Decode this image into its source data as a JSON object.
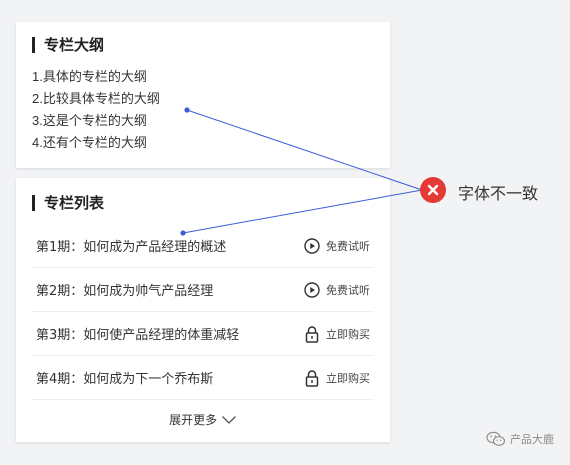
{
  "outline": {
    "title": "专栏大纲",
    "items": [
      "1.具体的专栏的大纲",
      "2.比较具体专栏的大纲",
      "3.这是个专栏的大纲",
      "4.还有个专栏的大纲"
    ]
  },
  "list": {
    "title": "专栏列表",
    "rows": [
      {
        "title": "第1期：如何成为产品经理的概述",
        "action": "免费试听",
        "icon": "play-icon"
      },
      {
        "title": "第2期：如何成为帅气产品经理",
        "action": "免费试听",
        "icon": "play-icon"
      },
      {
        "title": "第3期：如何使产品经理的体重减轻",
        "action": "立即购买",
        "icon": "lock-icon"
      },
      {
        "title": "第4期：如何成为下一个乔布斯",
        "action": "立即购买",
        "icon": "lock-icon"
      }
    ],
    "more_label": "展开更多"
  },
  "annotation": {
    "label": "字体不一致",
    "color": "#e53935",
    "line_color": "#3d5bd9"
  },
  "watermark": {
    "label": "产品大鹿"
  }
}
